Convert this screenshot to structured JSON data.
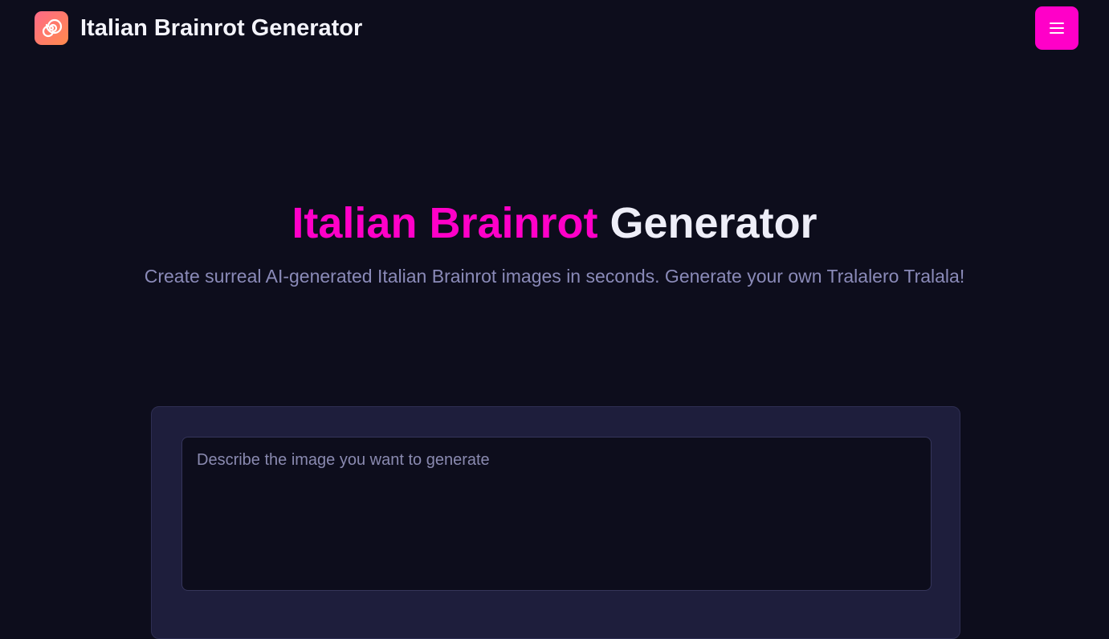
{
  "header": {
    "brand_title": "Italian Brainrot Generator",
    "logo_icon": "spiral-icon",
    "menu_icon": "hamburger-menu-icon"
  },
  "hero": {
    "title_accent": "Italian Brainrot",
    "title_plain": "Generator",
    "subtitle": "Create surreal AI-generated Italian Brainrot images in seconds. Generate your own Tralalero Tralala!"
  },
  "generator": {
    "prompt_placeholder": "Describe the image you want to generate",
    "prompt_value": ""
  },
  "colors": {
    "background": "#0d0d1c",
    "accent": "#ff00c8",
    "card": "#1e1e3c",
    "muted_text": "#8a8ab8"
  }
}
